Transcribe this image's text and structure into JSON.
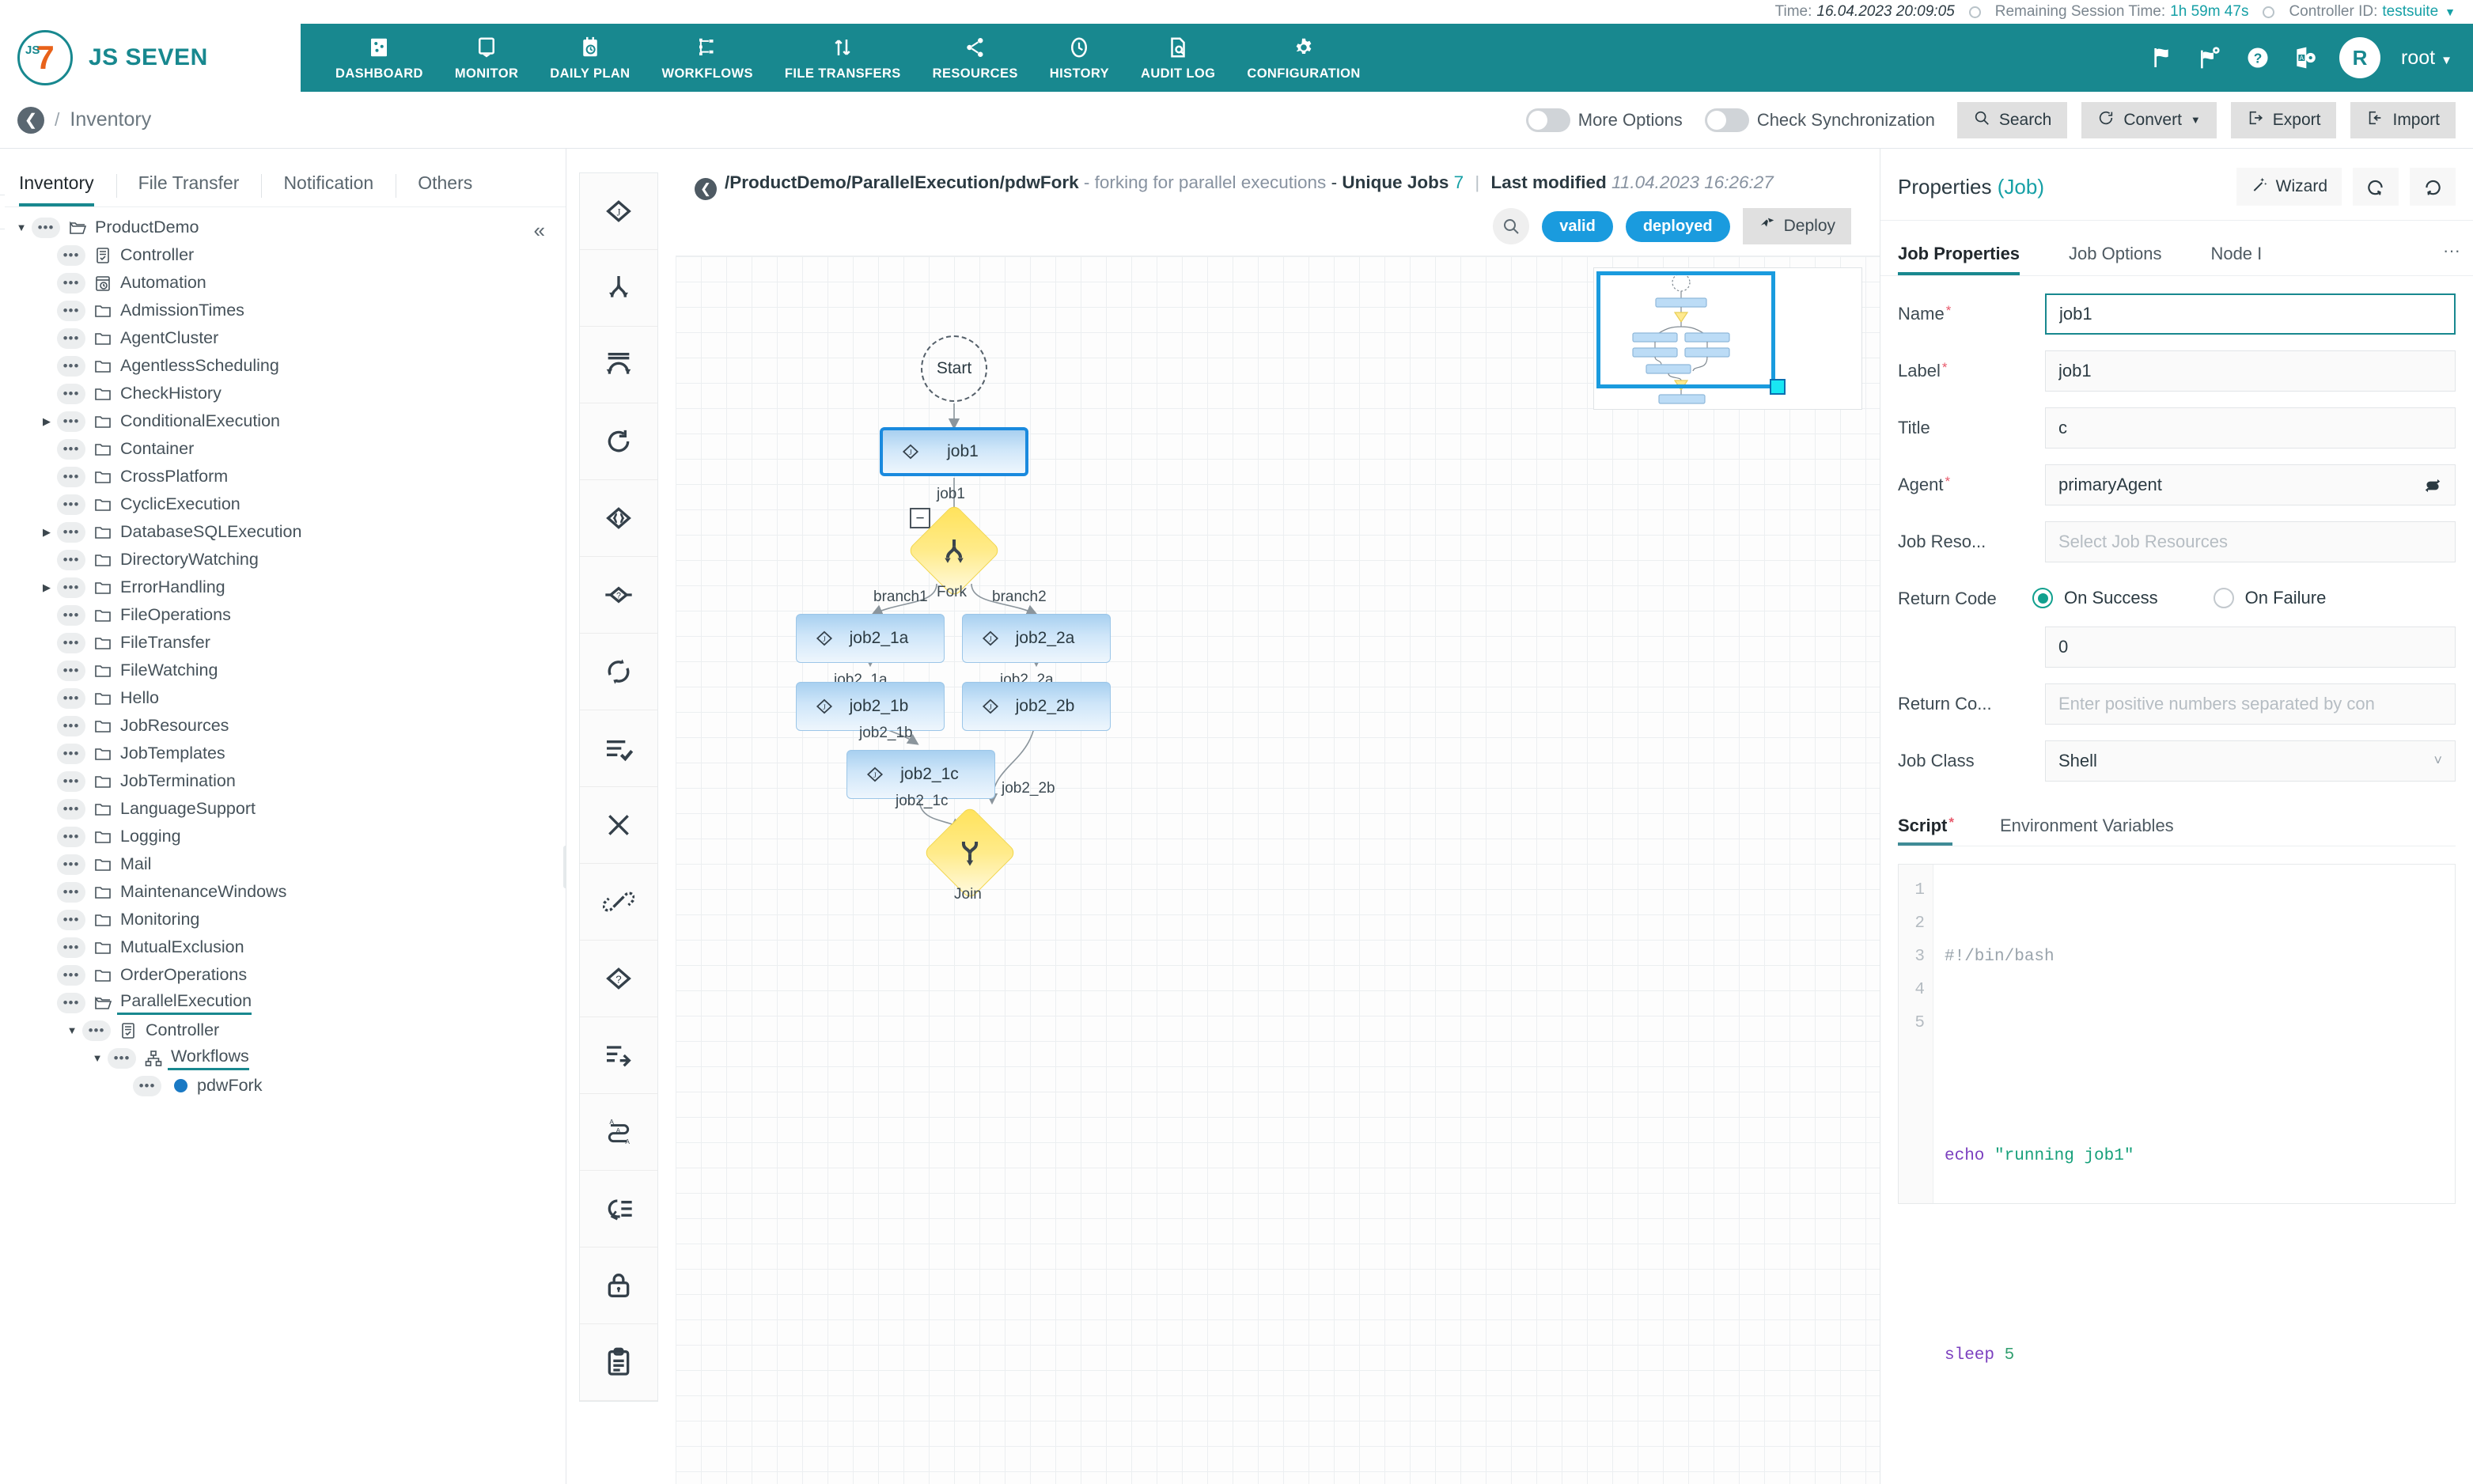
{
  "statusbar": {
    "time_label": "Time:",
    "time_value": "16.04.2023 20:09:05",
    "session_label": "Remaining Session Time:",
    "session_value": "1h 59m 47s",
    "controller_label": "Controller ID:",
    "controller_value": "testsuite"
  },
  "brand": {
    "mark": "7",
    "mark_small": "JS",
    "name": "JS SEVEN"
  },
  "nav": [
    {
      "label": "DASHBOARD",
      "icon": "dashboard-icon",
      "active": false
    },
    {
      "label": "MONITOR",
      "icon": "monitor-icon",
      "active": false
    },
    {
      "label": "DAILY PLAN",
      "icon": "daily-plan-icon",
      "active": false
    },
    {
      "label": "WORKFLOWS",
      "icon": "workflows-icon",
      "active": false
    },
    {
      "label": "FILE TRANSFERS",
      "icon": "file-transfers-icon",
      "active": false
    },
    {
      "label": "RESOURCES",
      "icon": "resources-icon",
      "active": false
    },
    {
      "label": "HISTORY",
      "icon": "history-icon",
      "active": false
    },
    {
      "label": "AUDIT LOG",
      "icon": "audit-log-icon",
      "active": false
    },
    {
      "label": "CONFIGURATION",
      "icon": "configuration-icon",
      "active": true
    }
  ],
  "header_right": {
    "avatar_letter": "R",
    "username": "root"
  },
  "subbar": {
    "breadcrumb_sep": "/",
    "breadcrumb": "Inventory",
    "more_options_label": "More Options",
    "check_sync_label": "Check Synchronization",
    "search_label": "Search",
    "convert_label": "Convert",
    "export_label": "Export",
    "import_label": "Import"
  },
  "left_tabs": [
    {
      "label": "Inventory",
      "active": true
    },
    {
      "label": "File Transfer",
      "active": false
    },
    {
      "label": "Notification",
      "active": false
    },
    {
      "label": "Others",
      "active": false
    }
  ],
  "tree": [
    {
      "label": "ProductDemo",
      "indent": 0,
      "twist": "down",
      "icon": "folder-open-icon"
    },
    {
      "label": "Controller",
      "indent": 1,
      "twist": "",
      "icon": "controller-icon"
    },
    {
      "label": "Automation",
      "indent": 1,
      "twist": "",
      "icon": "automation-icon"
    },
    {
      "label": "AdmissionTimes",
      "indent": 1,
      "twist": "",
      "icon": "folder-icon"
    },
    {
      "label": "AgentCluster",
      "indent": 1,
      "twist": "",
      "icon": "folder-icon"
    },
    {
      "label": "AgentlessScheduling",
      "indent": 1,
      "twist": "",
      "icon": "folder-icon"
    },
    {
      "label": "CheckHistory",
      "indent": 1,
      "twist": "",
      "icon": "folder-icon"
    },
    {
      "label": "ConditionalExecution",
      "indent": 1,
      "twist": "right",
      "icon": "folder-icon"
    },
    {
      "label": "Container",
      "indent": 1,
      "twist": "",
      "icon": "folder-icon"
    },
    {
      "label": "CrossPlatform",
      "indent": 1,
      "twist": "",
      "icon": "folder-icon"
    },
    {
      "label": "CyclicExecution",
      "indent": 1,
      "twist": "",
      "icon": "folder-icon"
    },
    {
      "label": "DatabaseSQLExecution",
      "indent": 1,
      "twist": "right",
      "icon": "folder-icon"
    },
    {
      "label": "DirectoryWatching",
      "indent": 1,
      "twist": "",
      "icon": "folder-icon"
    },
    {
      "label": "ErrorHandling",
      "indent": 1,
      "twist": "right",
      "icon": "folder-icon"
    },
    {
      "label": "FileOperations",
      "indent": 1,
      "twist": "",
      "icon": "folder-icon"
    },
    {
      "label": "FileTransfer",
      "indent": 1,
      "twist": "",
      "icon": "folder-icon"
    },
    {
      "label": "FileWatching",
      "indent": 1,
      "twist": "",
      "icon": "folder-icon"
    },
    {
      "label": "Hello",
      "indent": 1,
      "twist": "",
      "icon": "folder-icon"
    },
    {
      "label": "JobResources",
      "indent": 1,
      "twist": "",
      "icon": "folder-icon"
    },
    {
      "label": "JobTemplates",
      "indent": 1,
      "twist": "",
      "icon": "folder-icon"
    },
    {
      "label": "JobTermination",
      "indent": 1,
      "twist": "",
      "icon": "folder-icon"
    },
    {
      "label": "LanguageSupport",
      "indent": 1,
      "twist": "",
      "icon": "folder-icon"
    },
    {
      "label": "Logging",
      "indent": 1,
      "twist": "",
      "icon": "folder-icon"
    },
    {
      "label": "Mail",
      "indent": 1,
      "twist": "",
      "icon": "folder-icon"
    },
    {
      "label": "MaintenanceWindows",
      "indent": 1,
      "twist": "",
      "icon": "folder-icon"
    },
    {
      "label": "Monitoring",
      "indent": 1,
      "twist": "",
      "icon": "folder-icon"
    },
    {
      "label": "MutualExclusion",
      "indent": 1,
      "twist": "",
      "icon": "folder-icon"
    },
    {
      "label": "OrderOperations",
      "indent": 1,
      "twist": "",
      "icon": "folder-icon"
    },
    {
      "label": "ParallelExecution",
      "indent": 1,
      "twist": "",
      "icon": "folder-open-icon",
      "selected": true
    },
    {
      "label": "Controller",
      "indent": 2,
      "twist": "down",
      "icon": "controller-icon"
    },
    {
      "label": "Workflows",
      "indent": 3,
      "twist": "down",
      "icon": "workflows-tree-icon",
      "selected": true
    },
    {
      "label": "pdwFork",
      "indent": 4,
      "twist": "",
      "icon": "workflow-dot-icon"
    }
  ],
  "vtoolbar": [
    {
      "icon": "job-node-icon"
    },
    {
      "icon": "fork-node-icon"
    },
    {
      "icon": "join-node-icon"
    },
    {
      "icon": "retry-node-icon"
    },
    {
      "icon": "expression-node-icon"
    },
    {
      "icon": "if-node-icon"
    },
    {
      "icon": "cycle-node-icon"
    },
    {
      "icon": "finish-node-icon"
    },
    {
      "icon": "fail-node-icon"
    },
    {
      "icon": "break-node-icon"
    },
    {
      "icon": "question-node-icon"
    },
    {
      "icon": "add-order-node-icon"
    },
    {
      "icon": "post-notice-node-icon"
    },
    {
      "icon": "expect-notice-node-icon"
    },
    {
      "icon": "lock-node-icon"
    },
    {
      "icon": "board-node-icon"
    }
  ],
  "diagram_header": {
    "path": "/ProductDemo/ParallelExecution/pdwFork",
    "dash1": "-",
    "description": "forking for parallel executions",
    "dash2": "-",
    "unique_jobs_label": "Unique Jobs",
    "unique_jobs_count": "7",
    "pipe": "|",
    "last_modified_label": "Last modified",
    "last_modified_value": "11.04.2023 16:26:27",
    "valid_badge": "valid",
    "deployed_badge": "deployed",
    "deploy_label": "Deploy"
  },
  "workflow": {
    "start_label": "Start",
    "fork_label": "Fork",
    "join_label": "Join",
    "collapse_symbol": "−",
    "nodes": [
      {
        "name": "job1",
        "selected": true
      },
      {
        "name": "job2_1a",
        "selected": false
      },
      {
        "name": "job2_2a",
        "selected": false
      },
      {
        "name": "job2_1b",
        "selected": false
      },
      {
        "name": "job2_2b",
        "selected": false
      },
      {
        "name": "job2_1c",
        "selected": false
      }
    ],
    "edge_labels": [
      "job1",
      "branch1",
      "branch2",
      "job2_1a",
      "job2_2a",
      "job2_1b",
      "job2_2b",
      "job2_1c"
    ]
  },
  "properties": {
    "title": "Properties",
    "title_sub": "(Job)",
    "wizard_label": "Wizard",
    "tabs": [
      {
        "label": "Job Properties",
        "active": true
      },
      {
        "label": "Job Options",
        "active": false
      },
      {
        "label": "Node I",
        "active": false
      }
    ],
    "more_tabs": "···",
    "fields": {
      "name_label": "Name",
      "name_value": "job1",
      "label_label": "Label",
      "label_value": "job1",
      "title_label": "Title",
      "title_value": "c",
      "agent_label": "Agent",
      "agent_value": "primaryAgent",
      "job_resources_label": "Job Reso...",
      "job_resources_placeholder": "Select Job Resources",
      "return_code_label": "Return Code",
      "radio_success": "On Success",
      "radio_failure": "On Failure",
      "return_code_value": "0",
      "return_codes_label": "Return Co...",
      "return_codes_placeholder": "Enter positive numbers separated by con",
      "job_class_label": "Job Class",
      "job_class_value": "Shell"
    },
    "script_tabs": [
      {
        "label": "Script",
        "active": true,
        "required": true
      },
      {
        "label": "Environment Variables",
        "active": false,
        "required": false
      }
    ],
    "script_lines": [
      "1",
      "2",
      "3",
      "4",
      "5"
    ],
    "script_code": {
      "l1": "#!/bin/bash",
      "l3_kw": "echo",
      "l3_str": "\"running job1\"",
      "l5_kw": "sleep",
      "l5_num": "5"
    }
  },
  "colors": {
    "brand_teal": "#18888f",
    "accent_blue": "#1a9bde",
    "node_blue": "#a8d0f0",
    "gate_yellow": "#ffe259",
    "required_red": "#e8596b"
  }
}
